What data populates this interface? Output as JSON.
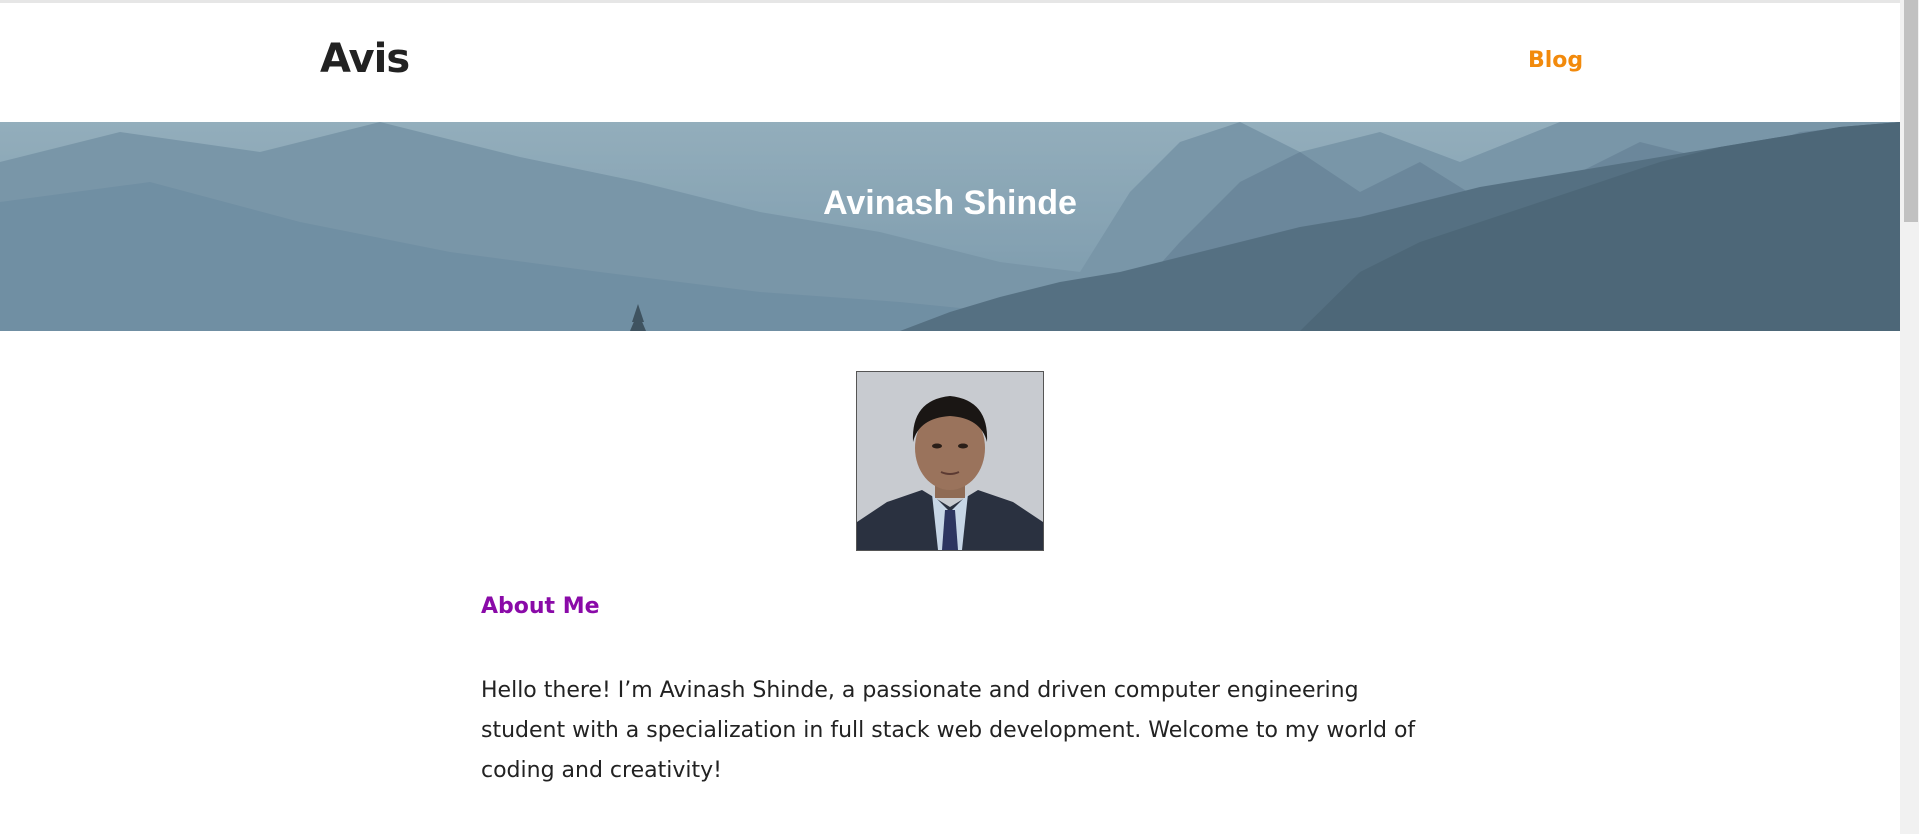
{
  "header": {
    "brand": "Avis",
    "nav": {
      "blog_label": "Blog"
    }
  },
  "hero": {
    "title": "Avinash Shinde"
  },
  "profile": {
    "photo_alt": "profile photo"
  },
  "about": {
    "heading": "About Me",
    "text": "Hello there! I’m Avinash Shinde, a passionate and driven computer engineering student with a specialization in full stack web development. Welcome to my world of coding and creativity!"
  },
  "colors": {
    "brand_text": "#222222",
    "nav_accent": "#f28a0c",
    "about_heading": "#8a0aa8",
    "hero_overlay": "#6f8fa3"
  }
}
